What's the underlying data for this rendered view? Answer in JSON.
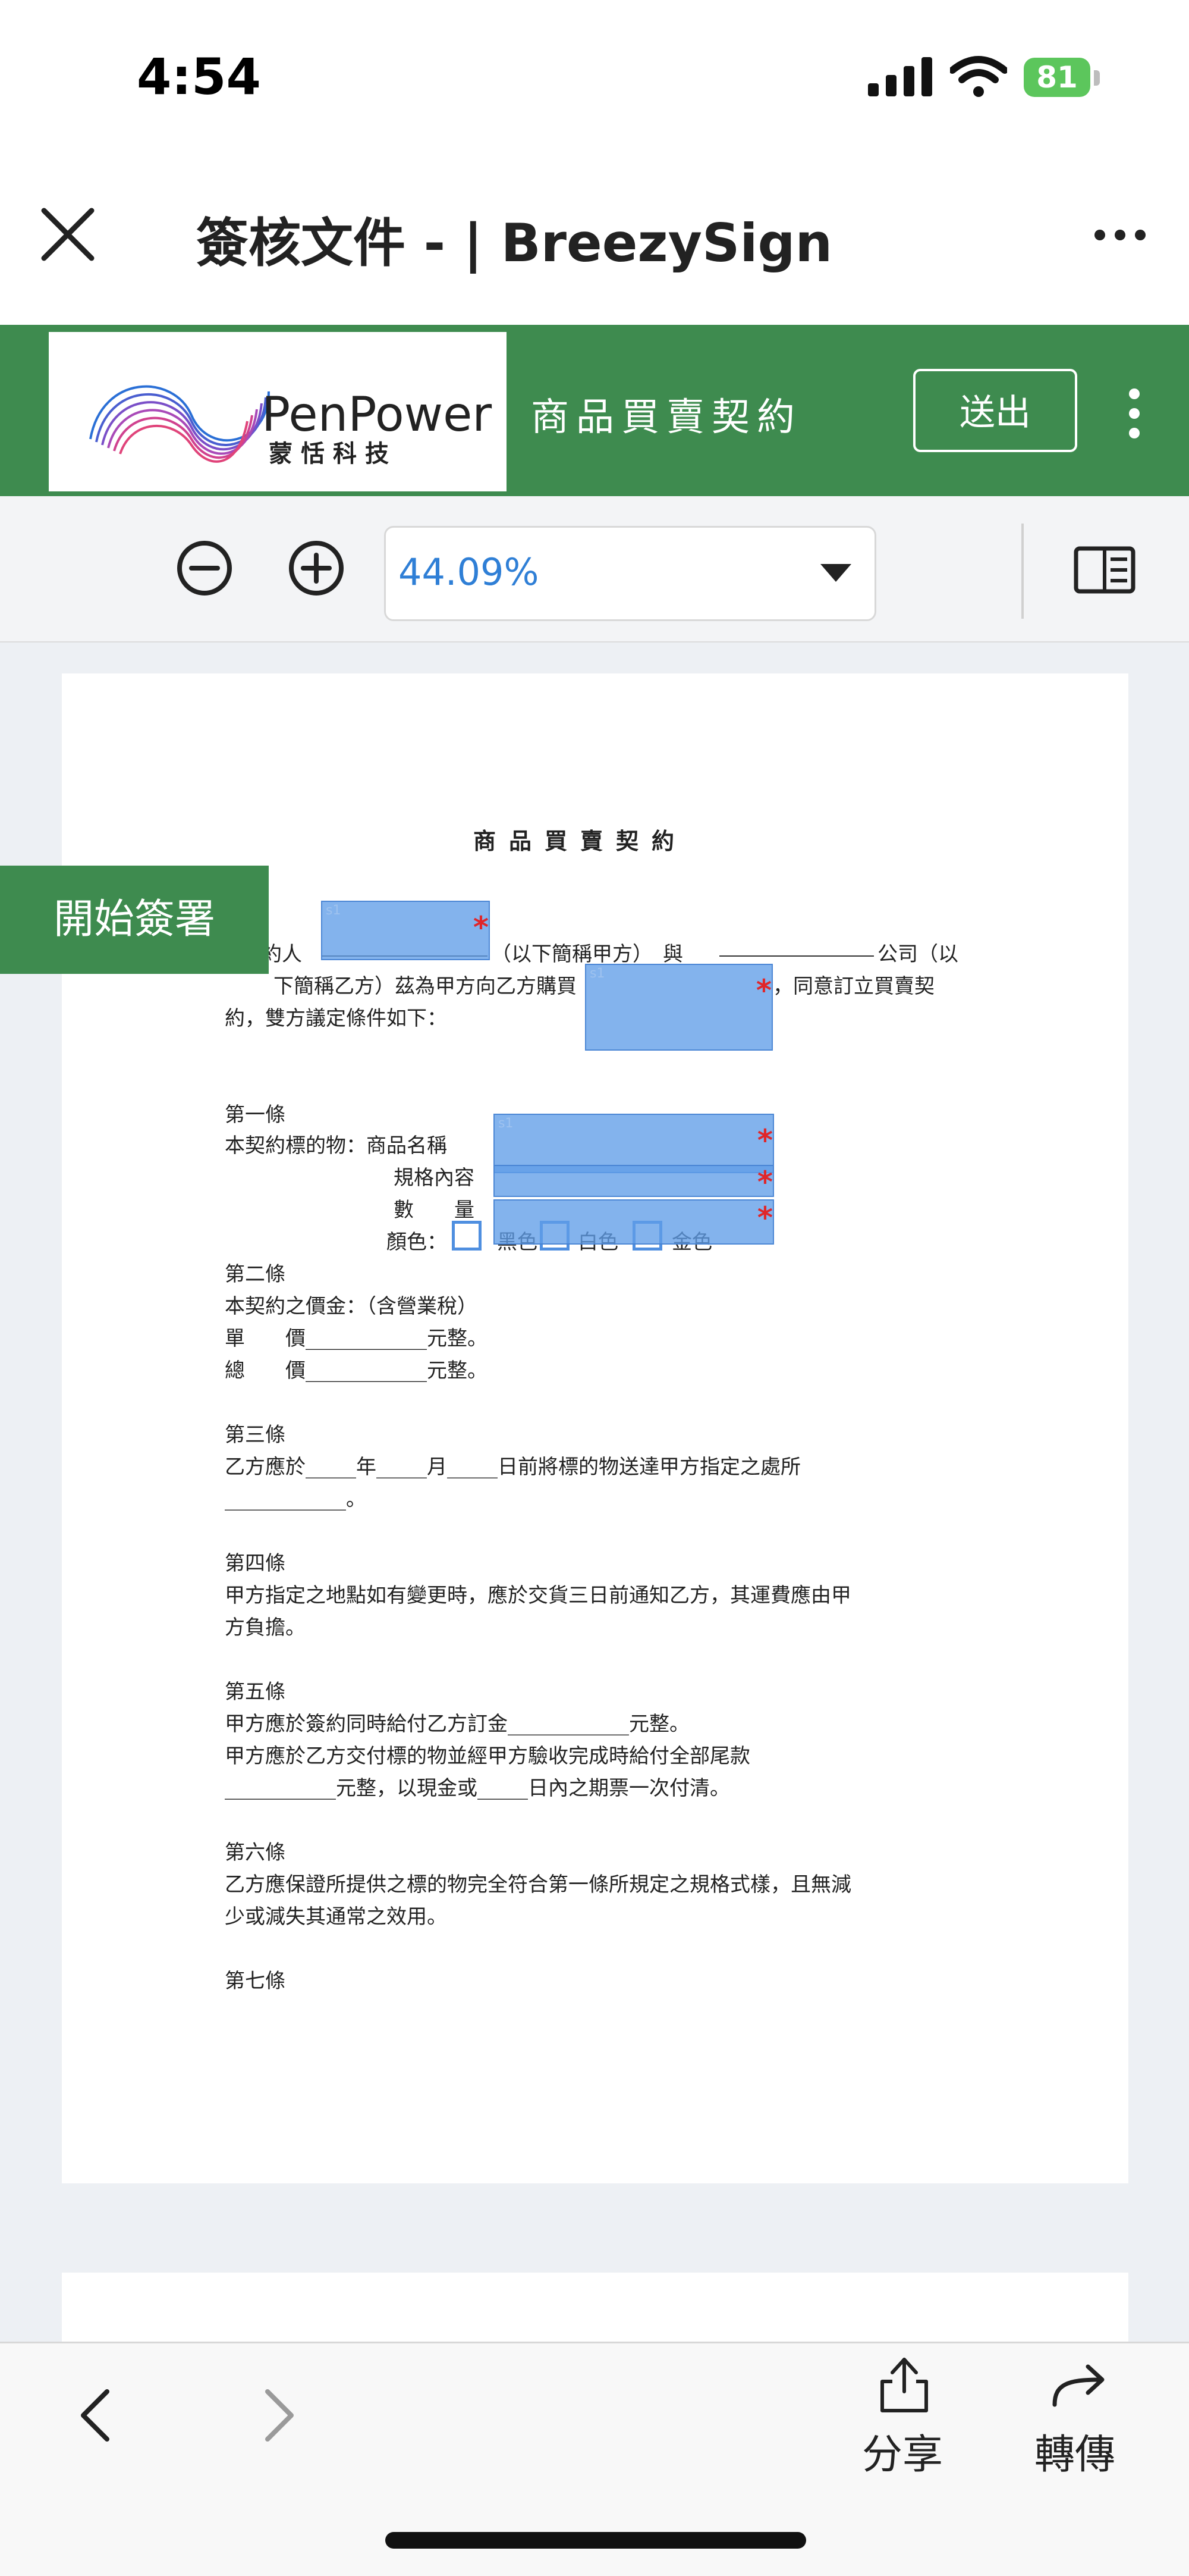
{
  "status_bar": {
    "time": "4:54",
    "battery": "81"
  },
  "header": {
    "title": "簽核文件 - | BreezySign"
  },
  "toolbar": {
    "logo_text": "PenPower",
    "logo_subtext": "蒙恬科技",
    "document_name": "商品買賣契約",
    "send_label": "送出"
  },
  "zoom": {
    "value": "44.09%"
  },
  "document": {
    "title": "商品買賣契約",
    "lines": [
      "約人",
      "（以下簡稱甲方）　與",
      "公司（以",
      "下簡稱乙方）茲為甲方向乙方購買",
      "，同意訂立買賣契",
      "約，雙方議定條件如下：",
      "第一條",
      "本契約標的物：商品名稱",
      "規格內容",
      "數　　量",
      "顏色：",
      "黑色",
      "白色",
      "金色",
      "第二條",
      "本契約之價金：（含營業稅）",
      "單　　價____________元整。",
      "總　　價____________元整。",
      "第三條",
      "乙方應於_____年_____月_____日前將標的物送達甲方指定之處所",
      "____________。",
      "第四條",
      "甲方指定之地點如有變更時，應於交貨三日前通知乙方，其運費應由甲",
      "方負擔。",
      "第五條",
      "甲方應於簽約同時給付乙方訂金____________元整。",
      "甲方應於乙方交付標的物並經甲方驗收完成時給付全部尾款",
      "___________元整，以現金或_____日內之期票一次付清。",
      "第六條",
      "乙方應保證所提供之標的物完全符合第一條所規定之規格式樣，且無減",
      "少或減失其通常之效用。",
      "第七條"
    ],
    "required_mark": "*",
    "field_id": "s1"
  },
  "start_sign_label": "開始簽署",
  "bottom_nav": {
    "share_label": "分享",
    "forward_label": "轉傳"
  }
}
